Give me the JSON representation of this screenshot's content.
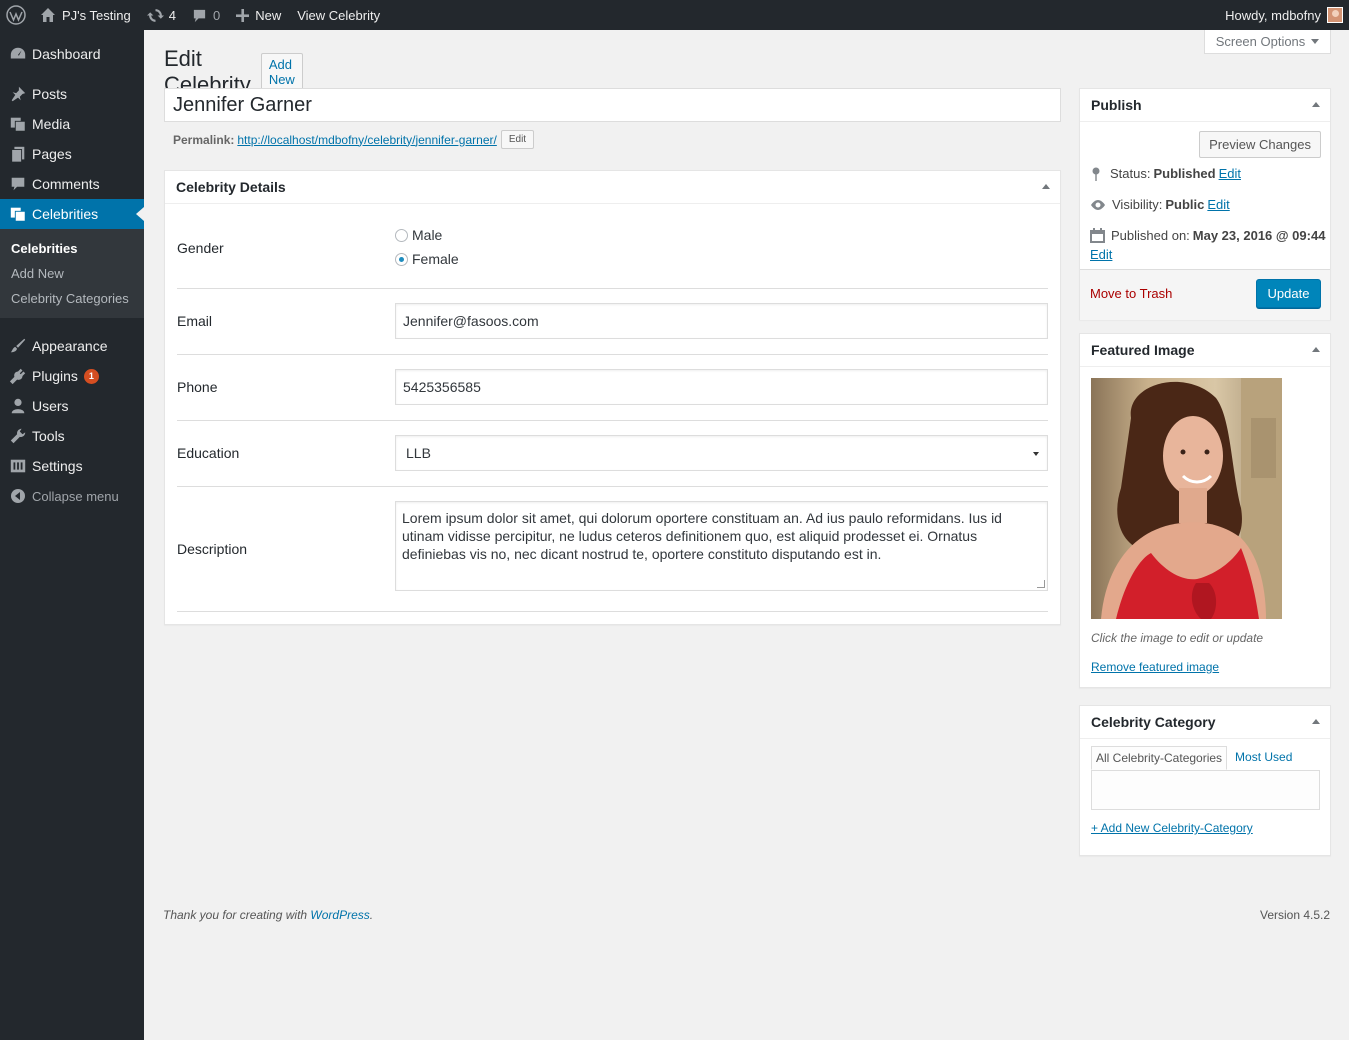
{
  "adminbar": {
    "site_name": "PJ's Testing",
    "updates_count": "4",
    "comments_count": "0",
    "new_label": "New",
    "view_label": "View Celebrity",
    "howdy": "Howdy, mdbofny"
  },
  "sidebar": {
    "items": [
      {
        "label": "Dashboard",
        "icon": "dashboard-icon"
      },
      {
        "label": "Posts",
        "icon": "pin-icon"
      },
      {
        "label": "Media",
        "icon": "media-icon"
      },
      {
        "label": "Pages",
        "icon": "page-icon"
      },
      {
        "label": "Comments",
        "icon": "comment-icon"
      },
      {
        "label": "Celebrities",
        "icon": "celebrities-icon"
      },
      {
        "label": "Appearance",
        "icon": "brush-icon"
      },
      {
        "label": "Plugins",
        "icon": "plugin-icon"
      },
      {
        "label": "Users",
        "icon": "user-icon"
      },
      {
        "label": "Tools",
        "icon": "wrench-icon"
      },
      {
        "label": "Settings",
        "icon": "settings-icon"
      }
    ],
    "submenu": [
      "Celebrities",
      "Add New",
      "Celebrity Categories"
    ],
    "plugins_badge": "1",
    "collapse_label": "Collapse menu"
  },
  "header": {
    "title": "Edit Celebrity",
    "add_new": "Add New",
    "screen_options": "Screen Options"
  },
  "post": {
    "title": "Jennifer Garner",
    "permalink_label": "Permalink:",
    "permalink_base": "http://localhost/mdbofny/celebrity/",
    "permalink_slug": "jennifer-garner",
    "permalink_trailing": "/",
    "permalink_edit": "Edit"
  },
  "details": {
    "title": "Celebrity Details",
    "gender_label": "Gender",
    "gender_options": [
      "Male",
      "Female"
    ],
    "gender_selected": "Female",
    "email_label": "Email",
    "email_value": "Jennifer@fasoos.com",
    "phone_label": "Phone",
    "phone_value": "5425356585",
    "education_label": "Education",
    "education_value": "LLB",
    "description_label": "Description",
    "description_value": "Lorem ipsum dolor sit amet, qui dolorum oportere constituam an. Ad ius paulo reformidans. Ius id utinam vidisse percipitur, ne ludus ceteros definitionem quo, est aliquid prodesset ei. Ornatus definiebas vis no, nec dicant nostrud te, oportere constituto disputando est in."
  },
  "publish": {
    "title": "Publish",
    "preview": "Preview Changes",
    "status_label": "Status:",
    "status_value": "Published",
    "visibility_label": "Visibility:",
    "visibility_value": "Public",
    "published_label": "Published on:",
    "published_value": "May 23, 2016 @ 09:44",
    "edit": "Edit",
    "trash": "Move to Trash",
    "update": "Update"
  },
  "featured": {
    "title": "Featured Image",
    "caption": "Click the image to edit or update",
    "remove": "Remove featured image"
  },
  "category": {
    "title": "Celebrity Category",
    "tab_all": "All Celebrity-Categories",
    "tab_most": "Most Used",
    "add_new": "+ Add New Celebrity-Category"
  },
  "footer": {
    "thanks_prefix": "Thank you for creating with ",
    "thanks_link": "WordPress",
    "thanks_suffix": ".",
    "version": "Version 4.5.2"
  },
  "colors": {
    "accent": "#0073aa",
    "sidebar_bg": "#23282d",
    "update_button": "#0085ba",
    "trash": "#aa0000"
  }
}
